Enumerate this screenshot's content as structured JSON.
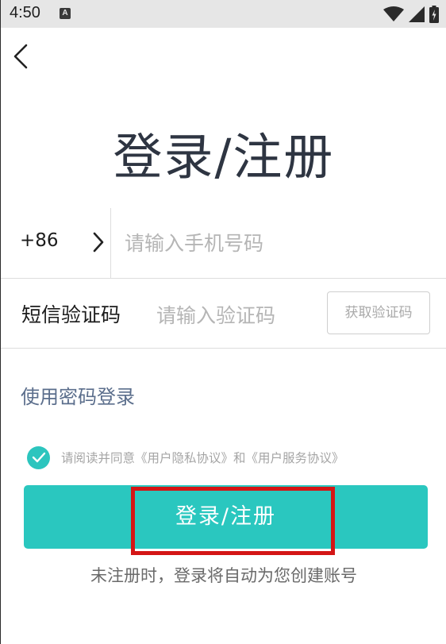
{
  "status_bar": {
    "time": "4:50",
    "notification_letter": "A",
    "icons": [
      "wifi-icon",
      "signal-icon",
      "battery-icon"
    ]
  },
  "header": {
    "back_icon": "chevron-left-icon"
  },
  "title": "登录/注册",
  "phone": {
    "country_code": "+86",
    "arrow_icon": "chevron-right-icon",
    "placeholder": "请输入手机号码",
    "value": ""
  },
  "sms": {
    "label": "短信验证码",
    "placeholder": "请输入验证码",
    "value": "",
    "get_code_label": "获取验证码"
  },
  "password_login_label": "使用密码登录",
  "agreement": {
    "checked": true,
    "text": "请阅读并同意《用户隐私协议》和《用户服务协议》"
  },
  "submit_label": "登录/注册",
  "note": "未注册时，登录将自动为您创建账号",
  "colors": {
    "accent": "#2ac7bf",
    "title": "#2e3542",
    "link": "#5b6e8c",
    "highlight": "#d41616",
    "placeholder": "#b5b5b5"
  }
}
